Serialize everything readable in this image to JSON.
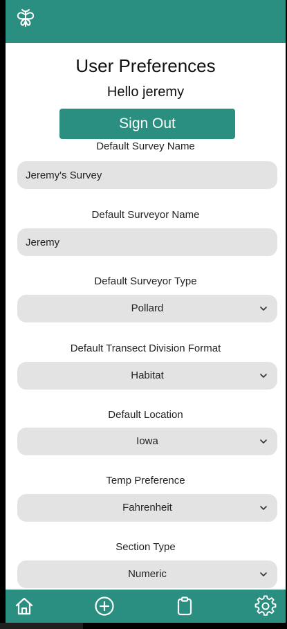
{
  "header": {
    "logo_icon": "butterfly-icon",
    "color": "#2a8f80"
  },
  "page": {
    "title": "User Preferences",
    "greeting": "Hello jeremy",
    "sign_out_label": "Sign Out"
  },
  "fields": {
    "survey_name": {
      "label": "Default Survey Name",
      "value": "Jeremy's Survey"
    },
    "surveyor_name": {
      "label": "Default Surveyor Name",
      "value": "Jeremy"
    },
    "surveyor_type": {
      "label": "Default Surveyor Type",
      "value": "Pollard"
    },
    "transect_division": {
      "label": "Default Transect Division Format",
      "value": "Habitat"
    },
    "location": {
      "label": "Default Location",
      "value": "Iowa"
    },
    "temp_preference": {
      "label": "Temp Preference",
      "value": "Fahrenheit"
    },
    "section_type": {
      "label": "Section Type",
      "value": "Numeric"
    }
  },
  "tabbar": {
    "items": [
      "home-icon",
      "add-circle-icon",
      "clipboard-icon",
      "gear-icon"
    ]
  },
  "colors": {
    "accent": "#2a8f80",
    "field_background": "#e3e3e3"
  }
}
